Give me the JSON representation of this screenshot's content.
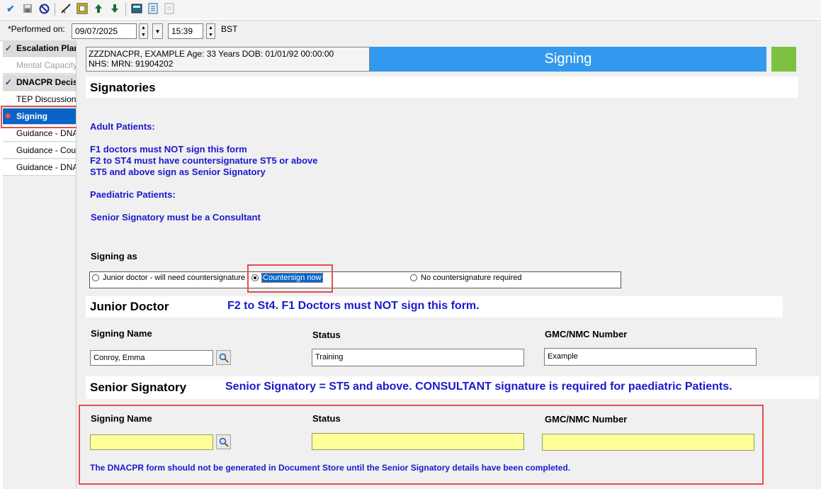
{
  "toolbar": {
    "icons": [
      "checkmark-icon",
      "save-icon",
      "cancel-icon",
      "pen-icon",
      "document-icon",
      "arrow-up-icon",
      "arrow-down-icon",
      "calculator-icon",
      "checklist-icon",
      "page-icon"
    ]
  },
  "performed": {
    "label": "*Performed on:",
    "date": "09/07/2025",
    "time": "15:39",
    "timezone": "BST"
  },
  "sidebar": {
    "items": [
      {
        "label": "Escalation Plan",
        "state": "header",
        "check": "✓"
      },
      {
        "label": "Mental Capacity A",
        "state": "disabled",
        "check": ""
      },
      {
        "label": "DNACPR Decisi",
        "state": "header",
        "check": "✓"
      },
      {
        "label": "TEP Discussion",
        "state": "normal",
        "check": ""
      },
      {
        "label": "Signing",
        "state": "active",
        "check": ""
      },
      {
        "label": "Guidance - DNAC",
        "state": "normal",
        "check": ""
      },
      {
        "label": "Guidance - Count",
        "state": "normal",
        "check": ""
      },
      {
        "label": "Guidance - DNAC",
        "state": "normal",
        "check": ""
      }
    ]
  },
  "patient": {
    "line1": "ZZZDNACPR, EXAMPLE Age: 33 Years DOB:  01/01/92 00:00:00",
    "line2": "NHS:  MRN: 91904202"
  },
  "section_banner": "Signing",
  "signatories_heading": "Signatories",
  "guidance": {
    "adult_heading": "Adult Patients:",
    "adult_lines": [
      "F1 doctors must NOT sign this form",
      "F2 to ST4 must have countersignature ST5 or above",
      "ST5 and above sign as Senior Signatory"
    ],
    "paed_heading": "Paediatric Patients:",
    "paed_line": "Senior Signatory must be a Consultant"
  },
  "signing_as": {
    "label": "Signing as",
    "options": [
      {
        "label": "Junior doctor - will need countersignature",
        "selected": false
      },
      {
        "label": "Countersign now",
        "selected": true
      },
      {
        "label": "No countersignature required",
        "selected": false
      }
    ]
  },
  "junior": {
    "heading": "Junior Doctor",
    "note": "F2 to St4. F1 Doctors must NOT sign this form.",
    "name_label": "Signing Name",
    "name_value": "Conroy, Emma",
    "status_label": "Status",
    "status_value": "Training",
    "gmc_label": "GMC/NMC Number",
    "gmc_value": "Example"
  },
  "senior": {
    "heading": "Senior Signatory",
    "note": "Senior Signatory = ST5 and above. CONSULTANT signature is required for paediatric Patients.",
    "name_label": "Signing Name",
    "name_value": "",
    "status_label": "Status",
    "status_value": "",
    "gmc_label": "GMC/NMC Number",
    "gmc_value": "",
    "warning": "The DNACPR form should not be generated in Document Store until the Senior Signatory details have been completed."
  },
  "colors": {
    "banner_blue": "#3399ee",
    "status_green": "#7cc142",
    "text_blue": "#1a1acc",
    "required_yellow": "#ffff99",
    "highlight_red": "#e05050",
    "active_blue": "#0a64c8"
  }
}
